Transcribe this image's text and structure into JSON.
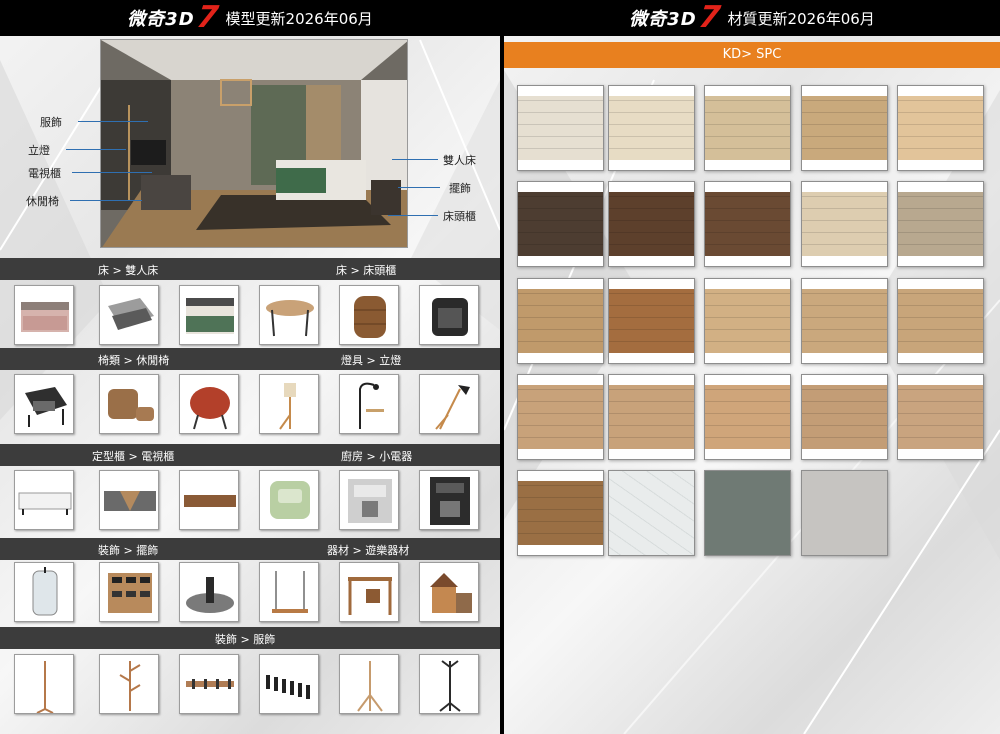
{
  "left_panel": {
    "header": {
      "brand": "微奇3D",
      "brand_number": "7",
      "title": "模型更新2026年06月"
    },
    "scene_callouts": {
      "left": [
        "服飾",
        "立燈",
        "電視櫃",
        "休閒椅"
      ],
      "right": [
        "雙人床",
        "擺飾",
        "床頭櫃"
      ]
    },
    "sections": [
      {
        "labels": [
          "床 > 雙人床",
          "床 > 床頭櫃"
        ],
        "items": [
          "double-bed-pink",
          "double-bed-recliner",
          "double-bed-green",
          "side-table-round",
          "nightstand-drum",
          "nightstand-black"
        ]
      },
      {
        "labels": [
          "椅類 > 休閒椅",
          "燈具 > 立燈"
        ],
        "items": [
          "lounge-chair-black",
          "lounge-chair-tan",
          "lounge-chair-red",
          "floor-lamp-tripod",
          "floor-lamp-arc",
          "floor-lamp-angled"
        ]
      },
      {
        "labels": [
          "定型櫃 > 電視櫃",
          "廚房 > 小電器"
        ],
        "items": [
          "tv-cabinet-white",
          "tv-cabinet-grey",
          "tv-cabinet-wood",
          "toaster-green",
          "espresso-machine-silver",
          "espresso-machine-black"
        ]
      },
      {
        "labels": [
          "裝飾 > 擺飾",
          "器材 > 遊樂器材"
        ],
        "items": [
          "glass-vase",
          "sunglasses-rack",
          "tray-decor",
          "swing-frame",
          "play-frame",
          "play-house"
        ]
      },
      {
        "labels": [
          "裝飾 > 服飾"
        ],
        "items": [
          "coat-stand-tall",
          "coat-stand-branch",
          "wall-hook-rail",
          "wall-hook-black",
          "coat-stand-wood",
          "coat-stand-black"
        ]
      }
    ]
  },
  "right_panel": {
    "header": {
      "brand": "微奇3D",
      "brand_number": "7",
      "title": "材質更新2026年06月"
    },
    "category": "KD> SPC",
    "swatches": [
      [
        "#e6dfd1",
        "#e7dcc4",
        "#d4bf99",
        "#c9a97c",
        "#e2c49a"
      ],
      [
        "#4d3d31",
        "#5d402c",
        "#6a4a33",
        "#ddcdb0",
        "#b8a88f"
      ],
      [
        "#c09a6b",
        "#a46d3f",
        "#d2b084",
        "#caa87d",
        "#c8a57a"
      ],
      [
        "#c8a27a",
        "#c8a27a",
        "#cfa57a",
        "#c39d76",
        "#c9a47f"
      ],
      [
        "#9a6f44",
        "#e9ecec",
        "#6f7a74",
        "#c6c4c1"
      ]
    ]
  }
}
